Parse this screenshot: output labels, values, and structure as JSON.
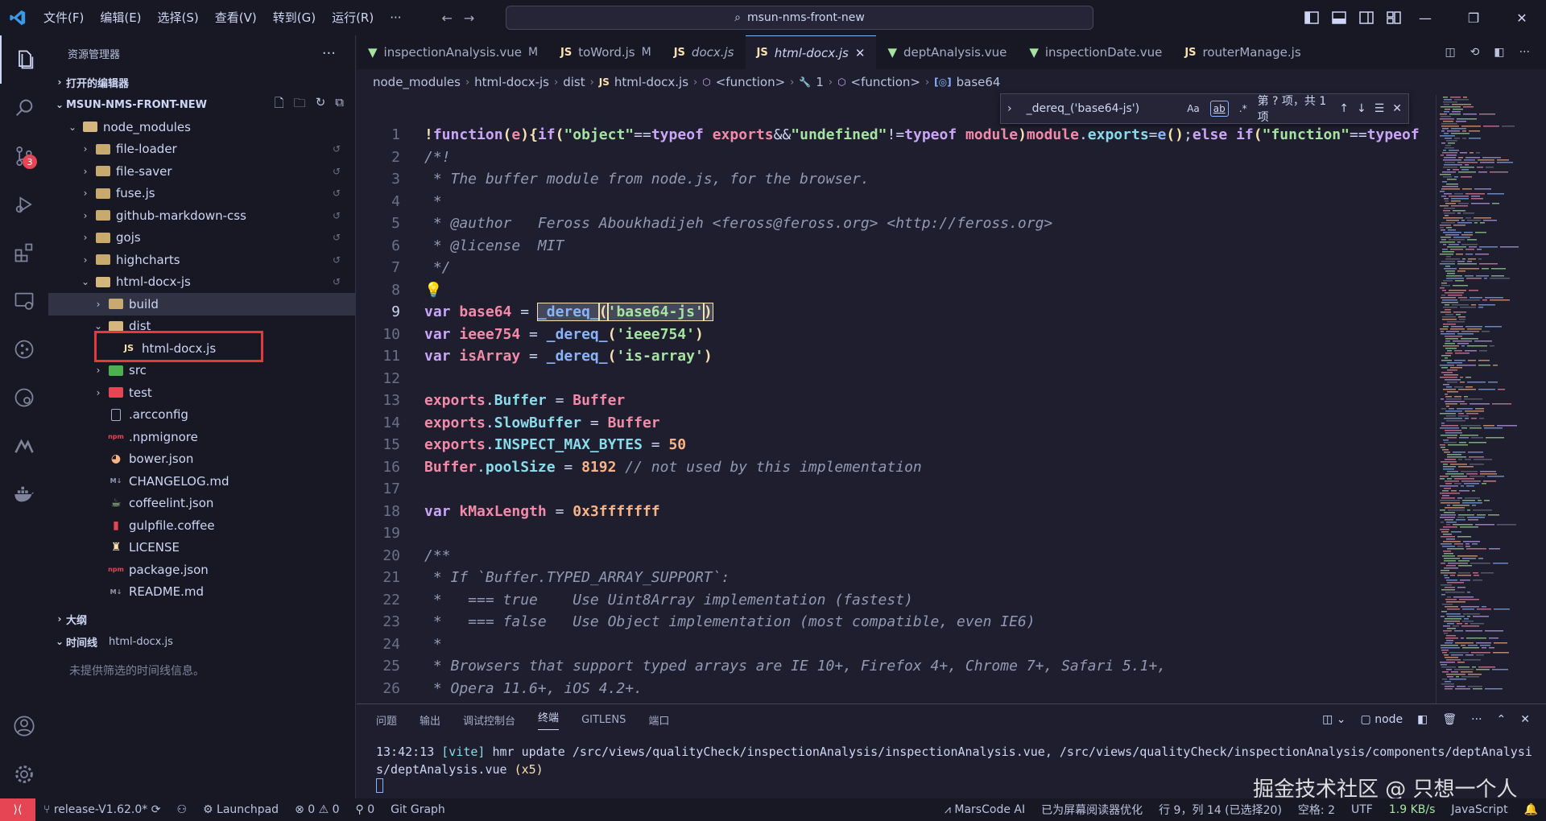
{
  "titlebar": {
    "menus": [
      "文件(F)",
      "编辑(E)",
      "选择(S)",
      "查看(V)",
      "转到(G)",
      "运行(R)",
      "···"
    ],
    "search": "msun-nms-front-new"
  },
  "activitybar": {
    "scm_badge": "3"
  },
  "sidebar": {
    "title": "资源管理器",
    "open_editors": "打开的编辑器",
    "project": "MSUN-NMS-FRONT-NEW",
    "tree": [
      {
        "label": "node_modules",
        "depth": 1,
        "kind": "folder-open",
        "chev": "⌄"
      },
      {
        "label": "file-loader",
        "depth": 2,
        "kind": "folder",
        "chev": "›",
        "git": "↺"
      },
      {
        "label": "file-saver",
        "depth": 2,
        "kind": "folder",
        "chev": "›",
        "git": "↺"
      },
      {
        "label": "fuse.js",
        "depth": 2,
        "kind": "folder",
        "chev": "›",
        "git": "↺"
      },
      {
        "label": "github-markdown-css",
        "depth": 2,
        "kind": "folder",
        "chev": "›",
        "git": "↺"
      },
      {
        "label": "gojs",
        "depth": 2,
        "kind": "folder",
        "chev": "›",
        "git": "↺"
      },
      {
        "label": "highcharts",
        "depth": 2,
        "kind": "folder",
        "chev": "›",
        "git": "↺"
      },
      {
        "label": "html-docx-js",
        "depth": 2,
        "kind": "folder-open",
        "chev": "⌄",
        "git": "↺"
      },
      {
        "label": "build",
        "depth": 3,
        "kind": "folder",
        "chev": "›",
        "selected": true
      },
      {
        "label": "dist",
        "depth": 3,
        "kind": "folder-open",
        "chev": "⌄"
      },
      {
        "label": "html-docx.js",
        "depth": 4,
        "kind": "js",
        "chev": ""
      },
      {
        "label": "src",
        "depth": 3,
        "kind": "folder-green",
        "chev": "›"
      },
      {
        "label": "test",
        "depth": 3,
        "kind": "folder-red",
        "chev": "›"
      },
      {
        "label": ".arcconfig",
        "depth": 3,
        "kind": "file",
        "chev": ""
      },
      {
        "label": ".npmignore",
        "depth": 3,
        "kind": "npm",
        "chev": ""
      },
      {
        "label": "bower.json",
        "depth": 3,
        "kind": "bower",
        "chev": ""
      },
      {
        "label": "CHANGELOG.md",
        "depth": 3,
        "kind": "md",
        "chev": ""
      },
      {
        "label": "coffeelint.json",
        "depth": 3,
        "kind": "coffee",
        "chev": ""
      },
      {
        "label": "gulpfile.coffee",
        "depth": 3,
        "kind": "gulp",
        "chev": ""
      },
      {
        "label": "LICENSE",
        "depth": 3,
        "kind": "license",
        "chev": ""
      },
      {
        "label": "package.json",
        "depth": 3,
        "kind": "npm",
        "chev": ""
      },
      {
        "label": "README.md",
        "depth": 3,
        "kind": "md",
        "chev": ""
      }
    ],
    "outline": "大纲",
    "timeline": "时间线",
    "timeline_file": "html-docx.js",
    "timeline_empty": "未提供筛选的时间线信息。"
  },
  "tabs": [
    {
      "label": "inspectionAnalysis.vue",
      "type": "vue",
      "mod": "M"
    },
    {
      "label": "toWord.js",
      "type": "js",
      "mod": "M"
    },
    {
      "label": "docx.js",
      "type": "js",
      "mod": "",
      "italic": true
    },
    {
      "label": "html-docx.js",
      "type": "js",
      "mod": "",
      "active": true,
      "italic": true
    },
    {
      "label": "deptAnalysis.vue",
      "type": "vue",
      "mod": ""
    },
    {
      "label": "inspectionDate.vue",
      "type": "vue",
      "mod": ""
    },
    {
      "label": "routerManage.js",
      "type": "js",
      "mod": ""
    }
  ],
  "breadcrumb": [
    "node_modules",
    "html-docx-js",
    "dist",
    "html-docx.js",
    "<function>",
    "1",
    "<function>",
    "base64"
  ],
  "find": {
    "query": "_dereq_('base64-js')",
    "case": "Aa",
    "word": "ab",
    "regex": ".*",
    "result": "第 ? 项，共 1 项"
  },
  "code": [
    [
      [
        "pu",
        "!"
      ],
      [
        "kw",
        "function"
      ],
      [
        "pu",
        "("
      ],
      [
        "vn",
        "e"
      ],
      [
        "pu",
        "){"
      ],
      [
        "kw",
        "if"
      ],
      [
        "pu",
        "("
      ],
      [
        "st",
        "\"object\""
      ],
      [
        "ct",
        "=="
      ],
      [
        "kw",
        "typeof"
      ],
      [
        "ct",
        " "
      ],
      [
        "vn",
        "exports"
      ],
      [
        "ct",
        "&&"
      ],
      [
        "st",
        "\"undefined\""
      ],
      [
        "ct",
        "!="
      ],
      [
        "kw",
        "typeof"
      ],
      [
        "ct",
        " "
      ],
      [
        "vn",
        "module"
      ],
      [
        "pu",
        ")"
      ],
      [
        "vn",
        "module"
      ],
      [
        "ct",
        "."
      ],
      [
        "pr",
        "exports"
      ],
      [
        "ct",
        "="
      ],
      [
        "fn",
        "e"
      ],
      [
        "pu",
        "()"
      ],
      [
        "ct",
        ";"
      ],
      [
        "kw",
        "else"
      ],
      [
        "ct",
        " "
      ],
      [
        "kw",
        "if"
      ],
      [
        "pu",
        "("
      ],
      [
        "st",
        "\"function\""
      ],
      [
        "ct",
        "=="
      ],
      [
        "kw",
        "typeof"
      ]
    ],
    [
      [
        "cm",
        "/*!"
      ]
    ],
    [
      [
        "cm",
        " * The buffer module from node.js, for the browser."
      ]
    ],
    [
      [
        "cm",
        " *"
      ]
    ],
    [
      [
        "cm",
        " * @author   Feross Aboukhadijeh <feross@feross.org> <http://feross.org>"
      ]
    ],
    [
      [
        "cm",
        " * @license  MIT"
      ]
    ],
    [
      [
        "cm",
        " */"
      ]
    ],
    [
      [
        "pu",
        "💡"
      ]
    ],
    [
      [
        "kw",
        "var"
      ],
      [
        "ct",
        " "
      ],
      [
        "vn",
        "base64"
      ],
      [
        "ct",
        " = "
      ],
      [
        "fn",
        "_dereq_"
      ],
      [
        "pu",
        "("
      ],
      [
        "st",
        "'base64-js'"
      ],
      [
        "pu",
        ")"
      ]
    ],
    [
      [
        "kw",
        "var"
      ],
      [
        "ct",
        " "
      ],
      [
        "vn",
        "ieee754"
      ],
      [
        "ct",
        " = "
      ],
      [
        "fn",
        "_dereq_"
      ],
      [
        "pu",
        "("
      ],
      [
        "st",
        "'ieee754'"
      ],
      [
        "pu",
        ")"
      ]
    ],
    [
      [
        "kw",
        "var"
      ],
      [
        "ct",
        " "
      ],
      [
        "vn",
        "isArray"
      ],
      [
        "ct",
        " = "
      ],
      [
        "fn",
        "_dereq_"
      ],
      [
        "pu",
        "("
      ],
      [
        "st",
        "'is-array'"
      ],
      [
        "pu",
        ")"
      ]
    ],
    [],
    [
      [
        "vn",
        "exports"
      ],
      [
        "ct",
        "."
      ],
      [
        "pr",
        "Buffer"
      ],
      [
        "ct",
        " = "
      ],
      [
        "vn",
        "Buffer"
      ]
    ],
    [
      [
        "vn",
        "exports"
      ],
      [
        "ct",
        "."
      ],
      [
        "pr",
        "SlowBuffer"
      ],
      [
        "ct",
        " = "
      ],
      [
        "vn",
        "Buffer"
      ]
    ],
    [
      [
        "vn",
        "exports"
      ],
      [
        "ct",
        "."
      ],
      [
        "pr",
        "INSPECT_MAX_BYTES"
      ],
      [
        "ct",
        " = "
      ],
      [
        "nu",
        "50"
      ]
    ],
    [
      [
        "vn",
        "Buffer"
      ],
      [
        "ct",
        "."
      ],
      [
        "pr",
        "poolSize"
      ],
      [
        "ct",
        " = "
      ],
      [
        "nu",
        "8192"
      ],
      [
        "ct",
        " "
      ],
      [
        "cm",
        "// not used by this implementation"
      ]
    ],
    [],
    [
      [
        "kw",
        "var"
      ],
      [
        "ct",
        " "
      ],
      [
        "vn",
        "kMaxLength"
      ],
      [
        "ct",
        " = "
      ],
      [
        "nu",
        "0x3fffffff"
      ]
    ],
    [],
    [
      [
        "cm",
        "/**"
      ]
    ],
    [
      [
        "cm",
        " * If `Buffer.TYPED_ARRAY_SUPPORT`:"
      ]
    ],
    [
      [
        "cm",
        " *   === true    Use Uint8Array implementation (fastest)"
      ]
    ],
    [
      [
        "cm",
        " *   === false   Use Object implementation (most compatible, even IE6)"
      ]
    ],
    [
      [
        "cm",
        " *"
      ]
    ],
    [
      [
        "cm",
        " * Browsers that support typed arrays are IE 10+, Firefox 4+, Chrome 7+, Safari 5.1+,"
      ]
    ],
    [
      [
        "cm",
        " * Opera 11.6+, iOS 4.2+."
      ]
    ]
  ],
  "current_line": 9,
  "panel": {
    "tabs": [
      "问题",
      "输出",
      "调试控制台",
      "终端",
      "GITLENS",
      "端口"
    ],
    "active_tab": "终端",
    "shell": "node",
    "term_time": "13:42:13",
    "term_tag": "[vite]",
    "term_msg": " hmr update /src/views/qualityCheck/inspectionAnalysis/inspectionAnalysis.vue, /src/views/qualityCheck/inspectionAnalysis/components/deptAnalysi",
    "term_msg2": "s/deptAnalysis.vue",
    "term_count": "(x5)"
  },
  "statusbar": {
    "branch": "release-V1.62.0*",
    "launchpad": "Launchpad",
    "problems": "⊗ 0 ⚠ 0",
    "ports": "0",
    "gitgraph": "Git Graph",
    "marscode": "MarsCode AI",
    "reader": "已为屏幕阅读器优化",
    "position": "行 9，列 14 (已选择20)",
    "spaces": "空格: 2",
    "encoding": "UTF",
    "speed": "1.9 KB/s",
    "lang": "JavaScript"
  },
  "watermark": "掘金技术社区 @ 只想一个人"
}
